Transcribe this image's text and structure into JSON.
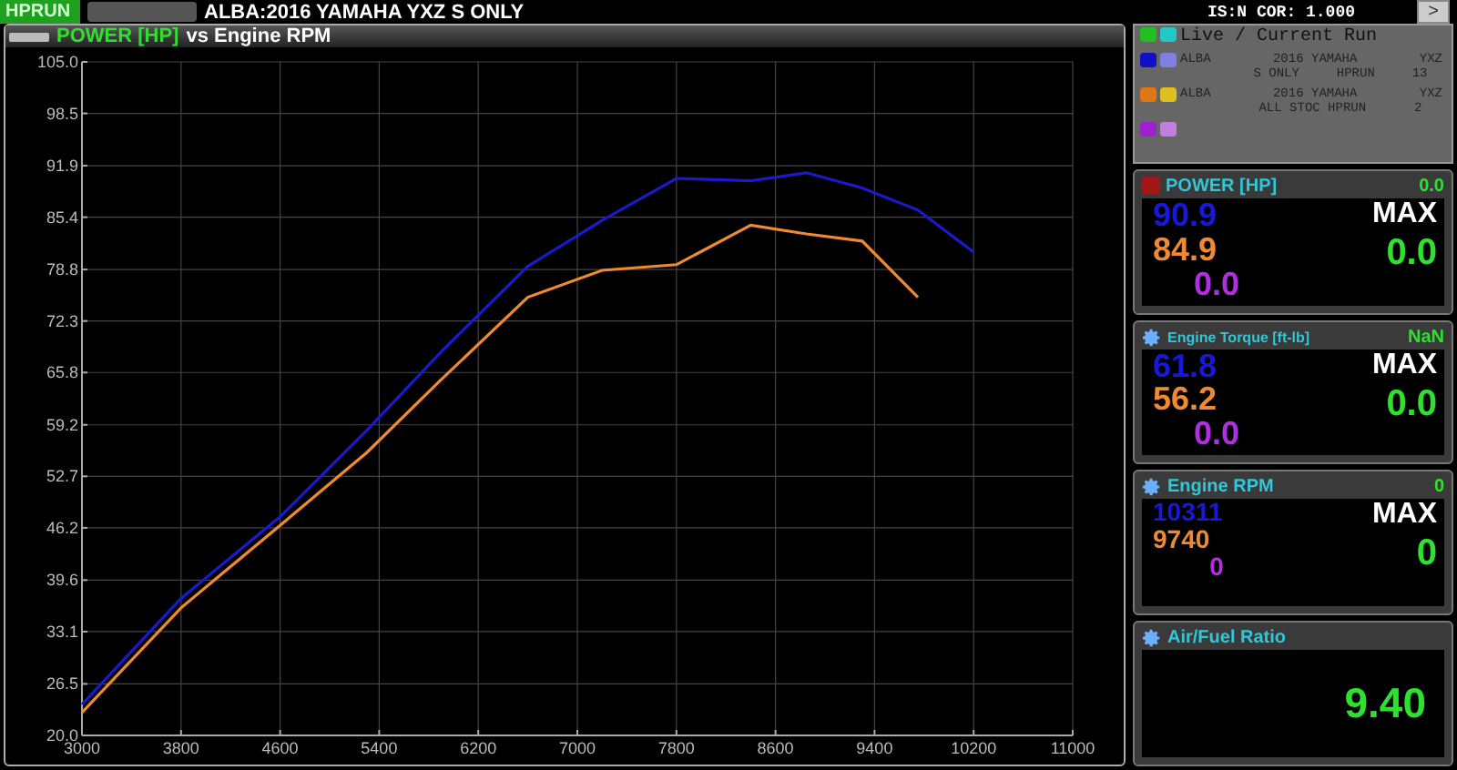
{
  "top_bar": {
    "mode": "HPRUN",
    "title": "ALBA:2016 YAMAHA YXZ S ONLY",
    "status": "IS:N COR: 1.000",
    "next_button": ">"
  },
  "chart_panel": {
    "metric": "POWER [HP]",
    "subtitle": "vs Engine RPM",
    "chart_data": {
      "type": "line",
      "grid": true,
      "xlim": [
        3000,
        11000
      ],
      "ylim": [
        20,
        105
      ],
      "xticks": [
        3000,
        3800,
        4600,
        5400,
        6200,
        7000,
        7800,
        8600,
        9400,
        10200,
        11000
      ],
      "yticks": [
        {
          "value": 20,
          "label": "20.0"
        },
        {
          "value": 26.5,
          "label": "26.5"
        },
        {
          "value": 33.1,
          "label": "33.1"
        },
        {
          "value": 39.6,
          "label": "39.6"
        },
        {
          "value": 46.2,
          "label": "46.2"
        },
        {
          "value": 52.7,
          "label": "52.7"
        },
        {
          "value": 59.2,
          "label": "59.2"
        },
        {
          "value": 65.8,
          "label": "65.8"
        },
        {
          "value": 72.3,
          "label": "72.3"
        },
        {
          "value": 78.8,
          "label": "78.8"
        },
        {
          "value": 85.4,
          "label": "85.4"
        },
        {
          "value": 91.9,
          "label": "91.9"
        },
        {
          "value": 98.5,
          "label": "98.5"
        },
        {
          "value": 105,
          "label": "105.0"
        }
      ],
      "x": [
        3000,
        3800,
        4600,
        5300,
        5900,
        6600,
        7200,
        7800,
        8400,
        8850,
        9300,
        9750,
        10200
      ],
      "series": [
        {
          "color": "#1a1acc",
          "values": [
            23.9,
            37.3,
            47.6,
            58.5,
            68.4,
            79.2,
            85,
            90.3,
            90,
            91,
            89.1,
            86.3,
            81
          ]
        },
        {
          "color": "#f08a30",
          "values": [
            22.9,
            36.1,
            46.5,
            55.7,
            64.9,
            75.3,
            78.7,
            79.4,
            84.4,
            83.3,
            82.4,
            75.3,
            null
          ]
        }
      ]
    }
  },
  "legend": {
    "title": "Live / Current Run",
    "entries": [
      {
        "swatches": [
          {
            "color": "#1010c8"
          },
          {
            "color": "#8080e0"
          }
        ],
        "line1": [
          "ALBA",
          "2016 YAMAHA",
          "YXZ"
        ],
        "line2": [
          "S ONLY",
          "HPRUN",
          "13"
        ]
      },
      {
        "swatches": [
          {
            "color": "#e07818"
          },
          {
            "color": "#e0c020"
          }
        ],
        "line1": [
          "ALBA",
          "2016 YAMAHA",
          "YXZ"
        ],
        "line2": [
          "ALL STOC HPRUN",
          "2"
        ]
      },
      {
        "swatches": [
          {
            "color": "#a020d0"
          },
          {
            "color": "#c080e0"
          }
        ]
      }
    ],
    "live_swatches": [
      {
        "color": "#20c020"
      },
      {
        "color": "#20c8c8"
      }
    ]
  },
  "gauges": [
    {
      "kind": "max",
      "title": "POWER [HP]",
      "badge": "0.0",
      "values": [
        "90.9",
        "84.9",
        "0.0"
      ],
      "max_label": "MAX",
      "max_value": "0.0"
    },
    {
      "kind": "max",
      "title": "Engine Torque [ft-lb]",
      "badge": "NaN",
      "values": [
        "61.8",
        "56.2",
        "0.0"
      ],
      "max_label": "MAX",
      "max_value": "0.0"
    },
    {
      "kind": "max",
      "title": "Engine RPM",
      "badge": "0",
      "values": [
        "10311",
        "9740",
        "0"
      ],
      "max_label": "MAX",
      "max_value": "0"
    },
    {
      "kind": "single",
      "title": "Air/Fuel Ratio",
      "value": "9.40"
    }
  ]
}
